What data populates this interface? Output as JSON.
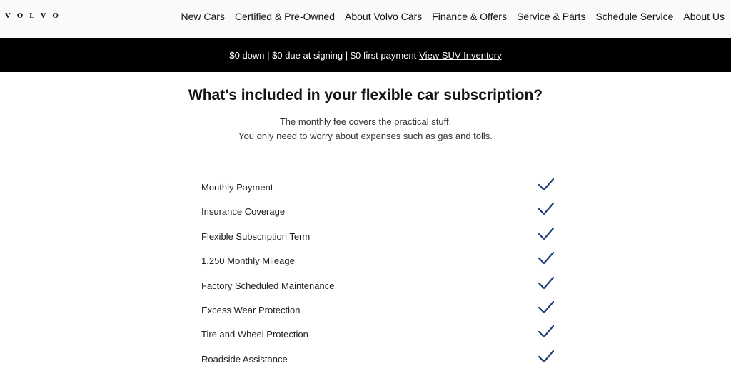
{
  "brand": {
    "logo_text": "VOLVO"
  },
  "nav": {
    "items": [
      "New Cars",
      "Certified & Pre-Owned",
      "About Volvo Cars",
      "Finance & Offers",
      "Service & Parts",
      "Schedule Service",
      "About Us"
    ]
  },
  "promo": {
    "text": "$0 down | $0 due at signing | $0 first payment",
    "link": "View SUV Inventory"
  },
  "main": {
    "title": "What's included in your flexible car subscription?",
    "subtitle_line1": "The monthly fee covers the practical stuff.",
    "subtitle_line2": "You only need to worry about expenses such as gas and tolls.",
    "features": [
      "Monthly Payment",
      "Insurance Coverage",
      "Flexible Subscription Term",
      "1,250 Monthly Mileage",
      "Factory Scheduled Maintenance",
      "Excess Wear Protection",
      "Tire and Wheel Protection",
      "Roadside Assistance"
    ]
  },
  "colors": {
    "check": "#1c3f75",
    "promo_bg": "#000000",
    "nav_bg": "#fafafa"
  },
  "icons": {
    "feature_included": "checkmark-icon"
  }
}
